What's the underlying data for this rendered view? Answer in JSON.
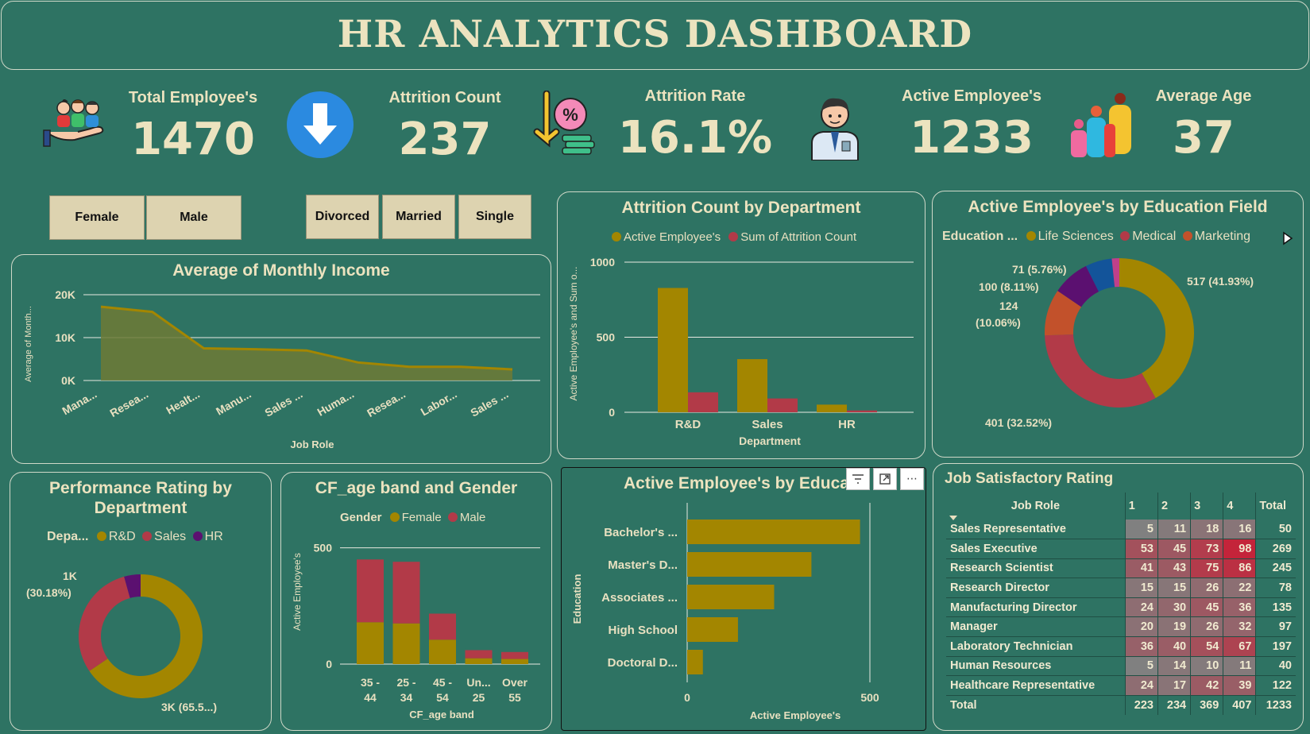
{
  "header": {
    "title": "HR ANALYTICS DASHBOARD"
  },
  "kpis": {
    "total_employees": {
      "label": "Total Employee's",
      "value": "1470",
      "icon": "people-hand-icon"
    },
    "attrition_count": {
      "label": "Attrition Count",
      "value": "237",
      "icon": "down-arrow-icon"
    },
    "attrition_rate": {
      "label": "Attrition Rate",
      "value": "16.1%",
      "icon": "percent-down-icon"
    },
    "active_employees": {
      "label": "Active Employee's",
      "value": "1233",
      "icon": "employee-icon"
    },
    "average_age": {
      "label": "Average Age",
      "value": "37",
      "icon": "family-icon"
    }
  },
  "slicers": {
    "gender": [
      "Female",
      "Male"
    ],
    "marital": [
      "Divorced",
      "Married",
      "Single"
    ]
  },
  "colors": {
    "gold": "#a38600",
    "red": "#b23a48",
    "purple": "#5b1070",
    "orange": "#c2512b",
    "blue": "#13549a",
    "magenta": "#c0408a",
    "bg": "#2e7363"
  },
  "monthly_income": {
    "title": "Average of Monthly Income",
    "chart_data": {
      "type": "area",
      "title": "Average of Monthly Income",
      "xlabel": "Job Role",
      "ylabel": "Average of Month...",
      "categories": [
        "Mana...",
        "Resea...",
        "Healt...",
        "Manu...",
        "Sales ...",
        "Huma...",
        "Resea...",
        "Labor...",
        "Sales ..."
      ],
      "values": [
        17200,
        16000,
        7500,
        7300,
        7000,
        4200,
        3200,
        3200,
        2600
      ],
      "ylim": [
        0,
        20000
      ],
      "yticks": [
        "0K",
        "10K",
        "20K"
      ]
    }
  },
  "attrition_by_dept": {
    "title": "Attrition Count by Department",
    "legend": [
      "Active Employee's",
      "Sum of Attrition Count"
    ],
    "chart_data": {
      "type": "bar",
      "title": "Attrition Count by Department",
      "xlabel": "Department",
      "ylabel": "Active Employee's and Sum o...",
      "categories": [
        "R&D",
        "Sales",
        "HR"
      ],
      "series": [
        {
          "name": "Active Employee's",
          "values": [
            828,
            354,
            51
          ]
        },
        {
          "name": "Sum of Attrition Count",
          "values": [
            133,
            92,
            12
          ]
        }
      ],
      "ylim": [
        0,
        1000
      ],
      "yticks": [
        "0",
        "500",
        "1000"
      ]
    }
  },
  "education_field": {
    "title": "Active Employee's by Education Field",
    "legend_title": "Education ...",
    "legend": [
      "Life Sciences",
      "Medical",
      "Marketing"
    ],
    "chart_data": {
      "type": "pie",
      "title": "Active Employee's by Education Field",
      "values": [
        517,
        401,
        124,
        100,
        71,
        20
      ],
      "labels": [
        "517 (41.93%)",
        "401 (32.52%)",
        "124 (10.06%)",
        "100 (8.11%)",
        "71 (5.76%)",
        ""
      ]
    },
    "label_124_a": "124",
    "label_124_b": "(10.06%)"
  },
  "performance": {
    "title_line1": "Performance Rating by",
    "title_line2": "Department",
    "legend_title": "Depa...",
    "legend": [
      "R&D",
      "Sales",
      "HR"
    ],
    "chart_data": {
      "type": "pie",
      "title": "Performance Rating by Department",
      "values": [
        65.5,
        30.18,
        4.3
      ],
      "labels": [
        "3K (65.5...)",
        "1K (30.18%)",
        ""
      ]
    },
    "label_1k_a": "1K",
    "label_1k_b": "(30.18%)"
  },
  "age_band": {
    "title": "CF_age band and Gender",
    "legend_title": "Gender",
    "legend": [
      "Female",
      "Male"
    ],
    "chart_data": {
      "type": "bar",
      "title": "CF_age band and Gender",
      "xlabel": "CF_age band",
      "ylabel": "Active Employee's",
      "categories": [
        "35 - 44",
        "25 - 34",
        "45 - 54",
        "Un... 25",
        "Over 55"
      ],
      "cat_line1": [
        "35 -",
        "25 -",
        "45 -",
        "Un...",
        "Over"
      ],
      "cat_line2": [
        "44",
        "34",
        "54",
        "25",
        "55"
      ],
      "series": [
        {
          "name": "Female",
          "values": [
            180,
            175,
            105,
            25,
            22
          ]
        },
        {
          "name": "Male",
          "values": [
            270,
            265,
            112,
            35,
            30
          ]
        }
      ],
      "ylim": [
        0,
        550
      ],
      "yticks": [
        "0",
        "500"
      ]
    }
  },
  "education": {
    "title": "Active Employee's by Educati",
    "chart_data": {
      "type": "bar",
      "title": "Active Employee's by Educati",
      "xlabel": "Active Employee's",
      "ylabel": "Education",
      "categories": [
        "Bachelor's ...",
        "Master's D...",
        "Associates ...",
        "High School",
        "Doctoral D..."
      ],
      "values": [
        473,
        340,
        238,
        139,
        43
      ],
      "xlim": [
        0,
        500
      ],
      "xticks": [
        "0",
        "500"
      ]
    },
    "tools": [
      "filter-icon",
      "focus-mode-icon",
      "more-options-icon"
    ],
    "more_label": "⋯"
  },
  "job_satisfaction": {
    "title": "Job Satisfactory Rating",
    "columns": [
      "Job Role",
      "1",
      "2",
      "3",
      "4",
      "Total"
    ],
    "rows": [
      {
        "role": "Sales Representative",
        "v": [
          5,
          11,
          18,
          16
        ],
        "total": 50
      },
      {
        "role": "Sales Executive",
        "v": [
          53,
          45,
          73,
          98
        ],
        "total": 269
      },
      {
        "role": "Research Scientist",
        "v": [
          41,
          43,
          75,
          86
        ],
        "total": 245
      },
      {
        "role": "Research Director",
        "v": [
          15,
          15,
          26,
          22
        ],
        "total": 78
      },
      {
        "role": "Manufacturing Director",
        "v": [
          24,
          30,
          45,
          36
        ],
        "total": 135
      },
      {
        "role": "Manager",
        "v": [
          20,
          19,
          26,
          32
        ],
        "total": 97
      },
      {
        "role": "Laboratory Technician",
        "v": [
          36,
          40,
          54,
          67
        ],
        "total": 197
      },
      {
        "role": "Human Resources",
        "v": [
          5,
          14,
          10,
          11
        ],
        "total": 40
      },
      {
        "role": "Healthcare Representative",
        "v": [
          24,
          17,
          42,
          39
        ],
        "total": 122
      }
    ],
    "totals": {
      "label": "Total",
      "v": [
        223,
        234,
        369,
        407
      ],
      "total": 1233
    }
  }
}
